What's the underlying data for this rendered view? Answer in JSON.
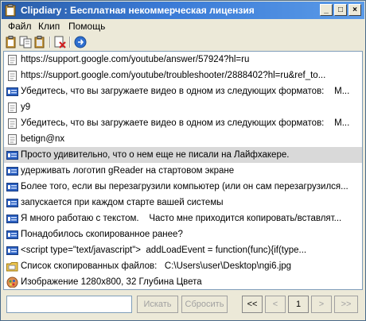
{
  "window": {
    "title": "Clipdiary : Бесплатная некоммерческая лицензия"
  },
  "title_buttons": [
    "_",
    "□",
    "×"
  ],
  "menu": [
    "Файл",
    "Клип",
    "Помощь"
  ],
  "toolbar": {
    "icons": [
      "paste-icon",
      "copy-icon",
      "copy-plain-icon",
      "delete-icon",
      "web-icon"
    ]
  },
  "list": [
    {
      "icon": "page",
      "text": "https://support.google.com/youtube/answer/57924?hl=ru"
    },
    {
      "icon": "page",
      "text": "https://support.google.com/youtube/troubleshooter/2888402?hl=ru&ref_to..."
    },
    {
      "icon": "rich",
      "text": "Убедитесь, что вы загружаете видео в одном из следующих форматов:    M..."
    },
    {
      "icon": "page",
      "text": "y9"
    },
    {
      "icon": "page",
      "text": "Убедитесь, что вы загружаете видео в одном из следующих форматов:    M..."
    },
    {
      "icon": "page",
      "text": "betign@nx"
    },
    {
      "icon": "rich",
      "text": "Просто удивительно, что о нем еще не писали на Лайфхакере.",
      "selected": true
    },
    {
      "icon": "rich",
      "text": "удерживать логотип gReader на стартовом экране"
    },
    {
      "icon": "rich",
      "text": "Более того, если вы перезагрузили компьютер (или он сам перезагрузился..."
    },
    {
      "icon": "rich",
      "text": "запускается при каждом старте вашей системы"
    },
    {
      "icon": "rich",
      "text": "Я много работаю с текстом.    Часто мне приходится копировать/вставлят..."
    },
    {
      "icon": "rich",
      "text": "Понадобилось скопированное ранее?"
    },
    {
      "icon": "rich",
      "text": "<script type=\"text/javascript\">  addLoadEvent = function(func){if(type..."
    },
    {
      "icon": "folder",
      "text": "Список скопированных файлов:   C:\\Users\\user\\Desktop\\ngi6.jpg"
    },
    {
      "icon": "image",
      "text": "Изображение 1280x800, 32 Глубина Цвета"
    }
  ],
  "bottom": {
    "search_value": "",
    "search_button": "Искать",
    "reset_button": "Сбросить",
    "nav_first": "<<",
    "nav_prev": "<",
    "page": "1",
    "nav_next": ">",
    "nav_last": ">>"
  },
  "colors": {
    "title_start": "#2b5ea8",
    "title_end": "#5b9be8",
    "selected_row": "#d9d9d9"
  }
}
